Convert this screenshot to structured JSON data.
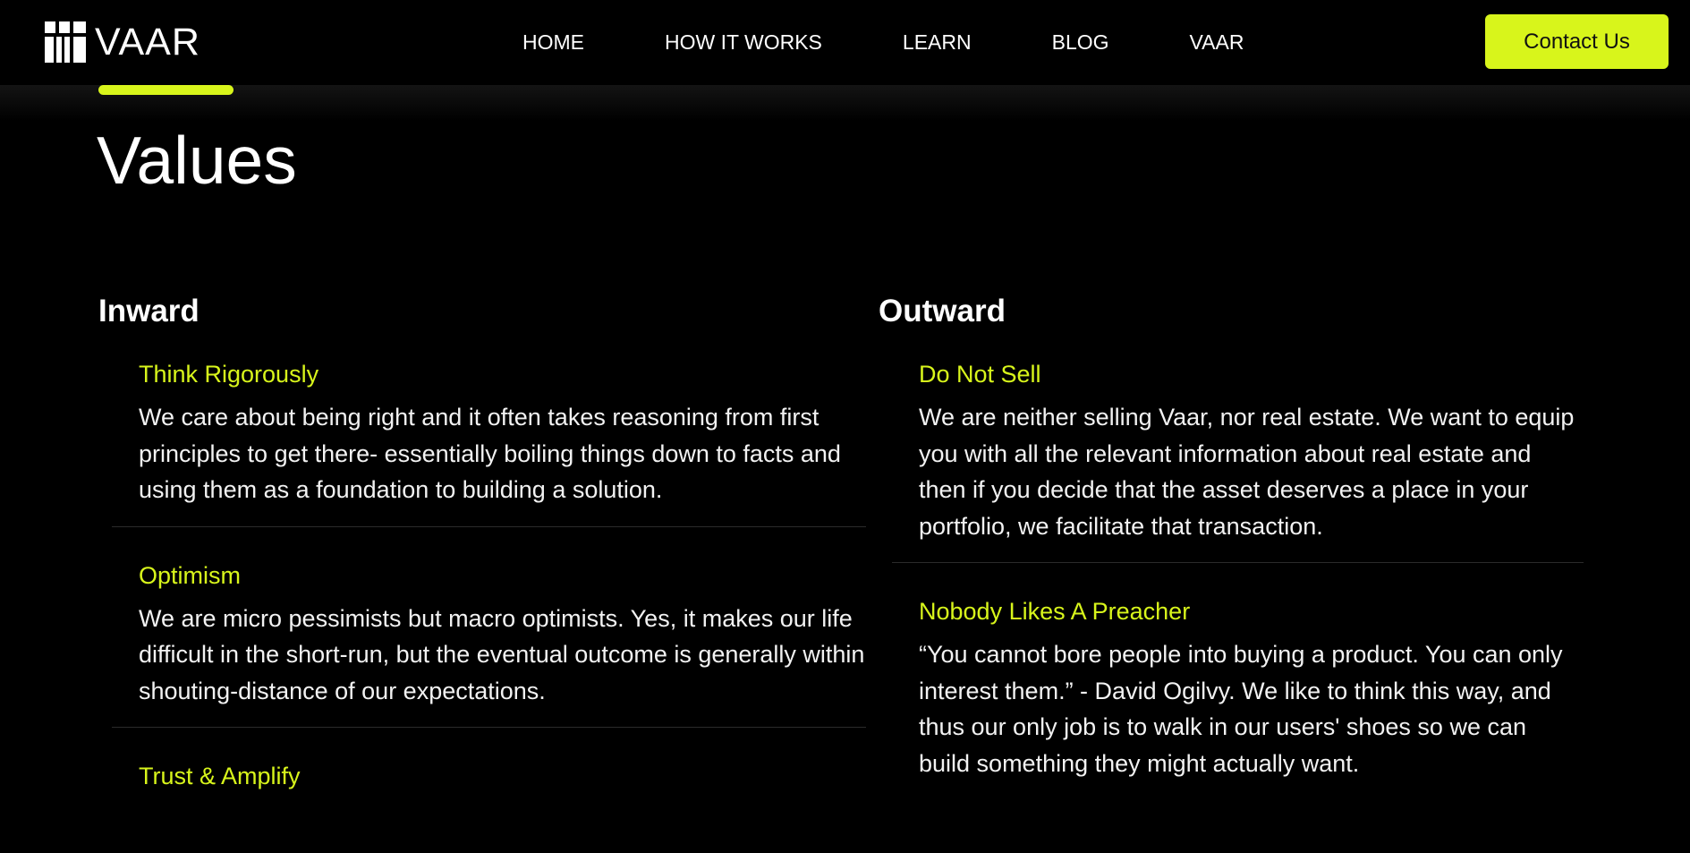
{
  "brand": {
    "name": "VAAR",
    "accent_color": "#d8f51b"
  },
  "nav": {
    "links": [
      "HOME",
      "HOW IT WORKS",
      "LEARN",
      "BLOG",
      "VAAR"
    ],
    "contact_label": "Contact Us"
  },
  "page": {
    "title": "Values"
  },
  "inward": {
    "heading": "Inward",
    "items": [
      {
        "title": "Think Rigorously",
        "text": "We care about being right and it often takes reasoning from first principles to get there- essentially boiling things down to facts and using them as a foundation to building a solution."
      },
      {
        "title": "Optimism",
        "text": "We are micro pessimists but macro optimists. Yes, it makes our life difficult in the short-run, but the eventual outcome is generally within shouting-distance of our expectations."
      },
      {
        "title": "Trust & Amplify",
        "text": ""
      }
    ]
  },
  "outward": {
    "heading": "Outward",
    "items": [
      {
        "title": "Do Not Sell",
        "text": "We are neither selling Vaar, nor real estate. We want to equip you with all the relevant information about real estate and then if you decide that the asset deserves a place in your portfolio, we facilitate that transaction."
      },
      {
        "title": "Nobody Likes A Preacher",
        "text": "“You cannot bore people into buying a product. You can only interest them.” - David Ogilvy. We like to think this way, and thus our only job is to walk in our users' shoes so we can build something they might actually want."
      }
    ]
  }
}
